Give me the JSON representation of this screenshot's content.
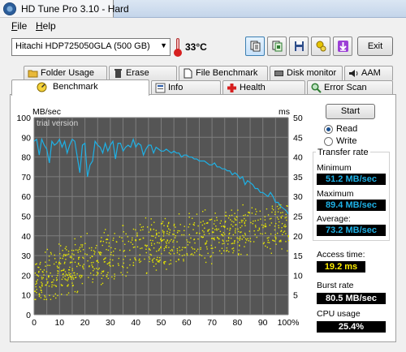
{
  "window": {
    "title": "HD Tune Pro 3.10 - Hard"
  },
  "menu": {
    "file": "File",
    "help": "Help"
  },
  "toolbar": {
    "drive": "Hitachi HDP725050GLA (500 GB)",
    "temperature": "33°C",
    "exit_label": "Exit",
    "buttons": [
      "copy-text-icon",
      "copy-screenshot-icon",
      "save-icon",
      "options-icon",
      "download-icon"
    ]
  },
  "tabs": {
    "row1": [
      "Folder Usage",
      "Erase",
      "File Benchmark",
      "Disk monitor",
      "AAM"
    ],
    "row2": [
      "Benchmark",
      "Info",
      "Health",
      "Error Scan"
    ],
    "active": "Benchmark"
  },
  "chart_data": {
    "type": "line",
    "watermark": "trial version",
    "y_left": {
      "unit": "MB/sec",
      "range": [
        0,
        100
      ],
      "ticks": [
        "0",
        "10",
        "20",
        "30",
        "40",
        "50",
        "60",
        "70",
        "80",
        "90",
        "100"
      ]
    },
    "y_right": {
      "unit": "ms",
      "range": [
        0,
        50
      ],
      "ticks": [
        "5",
        "10",
        "15",
        "20",
        "25",
        "30",
        "35",
        "40",
        "45",
        "50"
      ]
    },
    "x": {
      "range": [
        0,
        100
      ],
      "ticks": [
        "0",
        "10",
        "20",
        "30",
        "40",
        "50",
        "60",
        "70",
        "80",
        "90",
        "100%"
      ]
    },
    "grid": true,
    "colors": {
      "background": "#555555",
      "grid": "#7e7e7e",
      "transfer": "#1eb1e6",
      "access": "#e6e600"
    },
    "series": [
      {
        "name": "Transfer rate",
        "axis": "left",
        "x": [
          0,
          1,
          2,
          3,
          4,
          5,
          6,
          7,
          8,
          9,
          10,
          11,
          12,
          13,
          14,
          15,
          16,
          17,
          18,
          19,
          20,
          21,
          22,
          23,
          24,
          25,
          26,
          27,
          28,
          29,
          30,
          31,
          32,
          33,
          34,
          35,
          36,
          37,
          38,
          39,
          40,
          41,
          42,
          43,
          44,
          45,
          46,
          47,
          48,
          49,
          50,
          51,
          52,
          53,
          54,
          55,
          56,
          57,
          58,
          59,
          60,
          61,
          62,
          63,
          64,
          65,
          66,
          67,
          68,
          69,
          70,
          71,
          72,
          73,
          74,
          75,
          76,
          77,
          78,
          79,
          80,
          81,
          82,
          83,
          84,
          85,
          86,
          87,
          88,
          89,
          90,
          91,
          92,
          93,
          94,
          95,
          96,
          97,
          98,
          99,
          100
        ],
        "values": [
          88,
          89,
          81,
          89,
          86,
          84,
          77,
          88,
          86,
          87,
          89,
          85,
          88,
          82,
          86,
          89,
          88,
          80,
          72,
          86,
          87,
          70,
          76,
          78,
          88,
          86,
          85,
          82,
          87,
          83,
          86,
          88,
          79,
          87,
          87,
          83,
          85,
          86,
          85,
          89,
          85,
          87,
          86,
          81,
          84,
          86,
          86,
          82,
          85,
          84,
          83,
          83,
          84,
          83,
          82,
          83,
          82,
          82,
          80,
          81,
          81,
          80,
          80,
          79,
          79,
          78,
          78,
          78,
          77,
          76,
          76,
          77,
          75,
          75,
          74,
          74,
          73,
          73,
          71,
          72,
          71,
          69,
          70,
          66,
          68,
          67,
          66,
          64,
          64,
          62,
          62,
          61,
          60,
          62,
          60,
          57,
          57,
          55,
          54,
          53,
          51.2
        ]
      },
      {
        "name": "Access time",
        "axis": "right",
        "type": "scatter",
        "range_ms": [
          4,
          28
        ],
        "average": 19.2
      }
    ]
  },
  "controls": {
    "start_label": "Start",
    "read_label": "Read",
    "write_label": "Write",
    "mode": "read"
  },
  "stats": {
    "transfer_rate_title": "Transfer rate",
    "minimum_label": "Minimum",
    "minimum_value": "51.2 MB/sec",
    "maximum_label": "Maximum",
    "maximum_value": "89.4 MB/sec",
    "average_label": "Average:",
    "average_value": "73.2 MB/sec",
    "access_label": "Access time:",
    "access_value": "19.2 ms",
    "burst_label": "Burst rate",
    "burst_value": "80.5 MB/sec",
    "cpu_label": "CPU usage",
    "cpu_value": "25.4%"
  }
}
